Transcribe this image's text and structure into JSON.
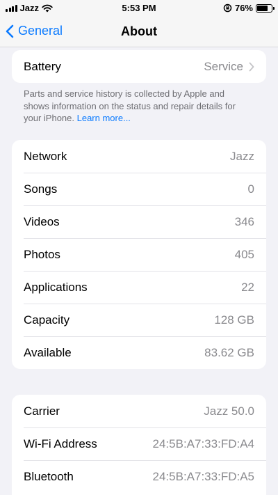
{
  "status_bar": {
    "carrier": "Jazz",
    "time": "5:53 PM",
    "battery_percent": "76%",
    "battery_level": 0.76,
    "icons": [
      "signal-icon",
      "wifi-icon",
      "orientation-lock-icon",
      "battery-icon"
    ]
  },
  "nav": {
    "back_label": "General",
    "title": "About"
  },
  "battery_group": {
    "label": "Battery",
    "value": "Service"
  },
  "footnote": {
    "text": "Parts and service history is collected by Apple and shows information on the status and repair details for your iPhone. ",
    "link": "Learn more..."
  },
  "info_rows": [
    {
      "label": "Network",
      "value": "Jazz"
    },
    {
      "label": "Songs",
      "value": "0"
    },
    {
      "label": "Videos",
      "value": "346"
    },
    {
      "label": "Photos",
      "value": "405"
    },
    {
      "label": "Applications",
      "value": "22"
    },
    {
      "label": "Capacity",
      "value": "128 GB"
    },
    {
      "label": "Available",
      "value": "83.62 GB"
    }
  ],
  "carrier_rows": [
    {
      "label": "Carrier",
      "value": "Jazz 50.0"
    },
    {
      "label": "Wi-Fi Address",
      "value": "24:5B:A7:33:FD:A4"
    },
    {
      "label": "Bluetooth",
      "value": "24:5B:A7:33:FD:A5"
    }
  ],
  "colors": {
    "accent": "#0a7aff",
    "background": "#f2f2f7",
    "secondary_text": "#8a8a8e"
  }
}
